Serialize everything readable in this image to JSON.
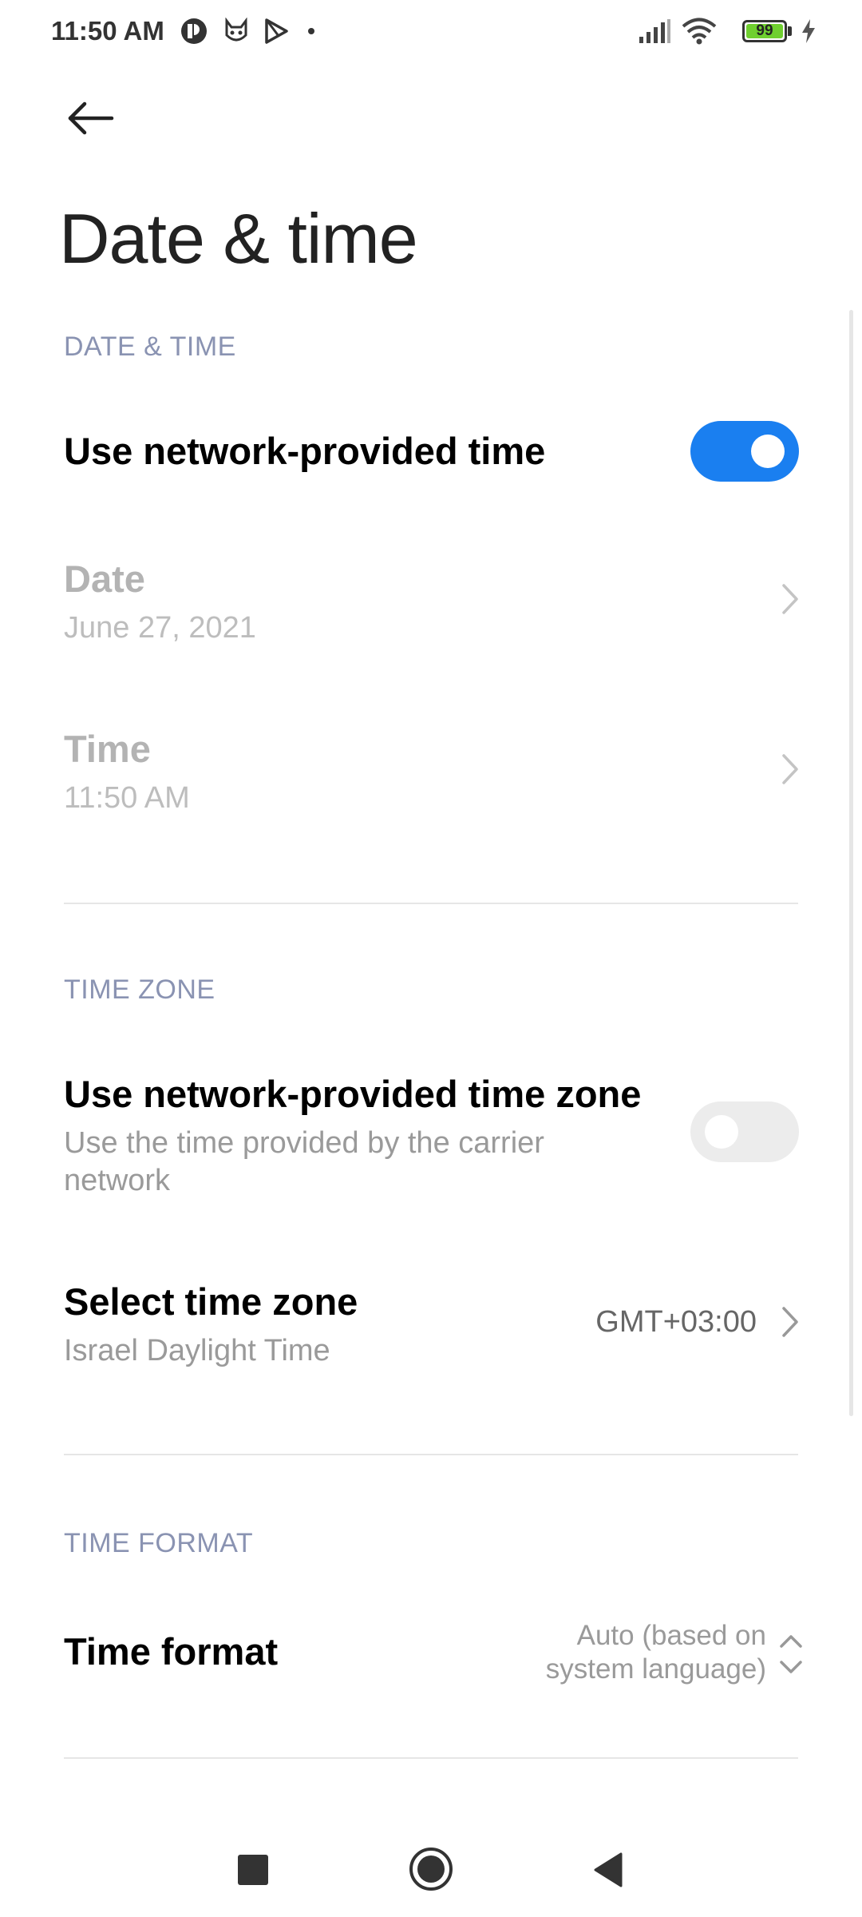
{
  "status_bar": {
    "time": "11:50 AM",
    "battery": "99",
    "icons": [
      "notification-app-icon",
      "cat-app-icon",
      "play-store-icon",
      "dot-icon",
      "signal-icon",
      "wifi-icon",
      "battery-icon",
      "charging-icon"
    ]
  },
  "header": {
    "back_icon": "back-arrow-icon",
    "title": "Date & time"
  },
  "sections": {
    "date_time": {
      "header": "DATE & TIME",
      "network_time": {
        "label": "Use network-provided time",
        "enabled": true
      },
      "date": {
        "label": "Date",
        "value": "June 27, 2021"
      },
      "time": {
        "label": "Time",
        "value": "11:50 AM"
      }
    },
    "time_zone": {
      "header": "TIME ZONE",
      "network_zone": {
        "label": "Use network-provided time zone",
        "sub1": "Use the time provided by the carrier",
        "sub2": "network",
        "enabled": false
      },
      "select_zone": {
        "label": "Select time zone",
        "sub": "Israel Daylight Time",
        "value": "GMT+03:00"
      }
    },
    "time_format": {
      "header": "TIME FORMAT",
      "format": {
        "label": "Time format",
        "value_line1": "Auto (based on",
        "value_line2": "system language)"
      }
    }
  },
  "nav_bar": {
    "recents": "square-recents-icon",
    "home": "circle-home-icon",
    "back": "triangle-back-icon"
  },
  "colors": {
    "accent": "#1a7ff0",
    "section_header": "#8a93b2"
  }
}
